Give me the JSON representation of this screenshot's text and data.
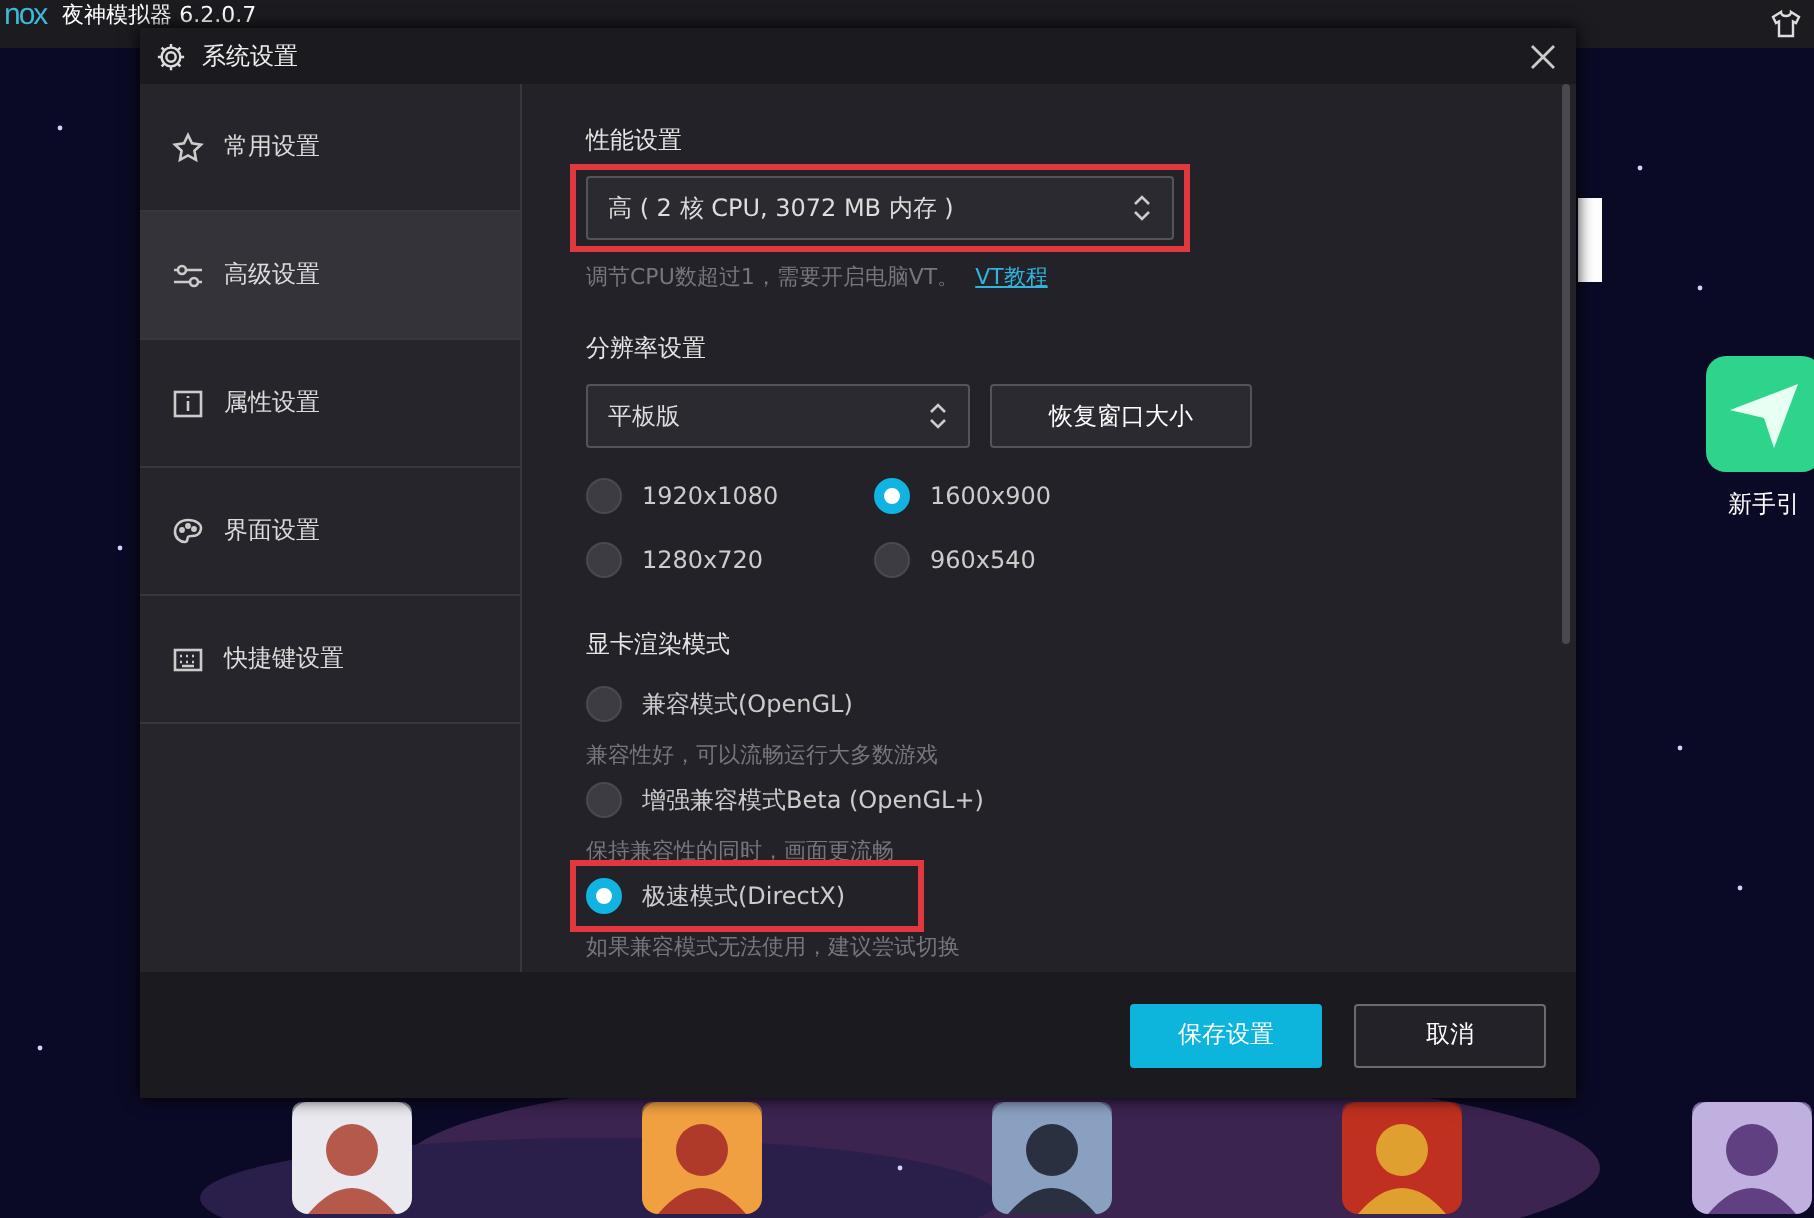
{
  "app_bar": {
    "logo": "nox",
    "title": "夜神模拟器 6.2.0.7"
  },
  "desktop": {
    "shortcut": {
      "label": "新手引"
    }
  },
  "dialog": {
    "title": "系统设置",
    "sidebar": [
      {
        "label": "常用设置",
        "selected": false
      },
      {
        "label": "高级设置",
        "selected": true
      },
      {
        "label": "属性设置",
        "selected": false
      },
      {
        "label": "界面设置",
        "selected": false
      },
      {
        "label": "快捷键设置",
        "selected": false
      }
    ],
    "performance": {
      "heading": "性能设置",
      "select": "高 ( 2 核 CPU, 3072 MB 内存 )",
      "highlighted": true,
      "hint": "调节CPU数超过1，需要开启电脑VT。",
      "link": "VT教程"
    },
    "resolution": {
      "heading": "分辨率设置",
      "select": "平板版",
      "button": "恢复窗口大小",
      "options": [
        {
          "label": "1920x1080",
          "selected": false
        },
        {
          "label": "1600x900",
          "selected": true
        },
        {
          "label": "1280x720",
          "selected": false
        },
        {
          "label": "960x540",
          "selected": false
        }
      ]
    },
    "render": {
      "heading": "显卡渲染模式",
      "options": [
        {
          "label": "兼容模式(OpenGL)",
          "selected": false,
          "highlighted": false,
          "hint": "兼容性好，可以流畅运行大多数游戏"
        },
        {
          "label": "增强兼容模式Beta (OpenGL+)",
          "selected": false,
          "highlighted": false,
          "hint": "保持兼容性的同时，画面更流畅"
        },
        {
          "label": "极速模式(DirectX)",
          "selected": true,
          "highlighted": true,
          "hint": "如果兼容模式无法使用，建议尝试切换"
        }
      ]
    },
    "buttons": [
      {
        "label": "保存设置",
        "kind": "primary"
      },
      {
        "label": "取消",
        "kind": "secondary"
      }
    ]
  }
}
